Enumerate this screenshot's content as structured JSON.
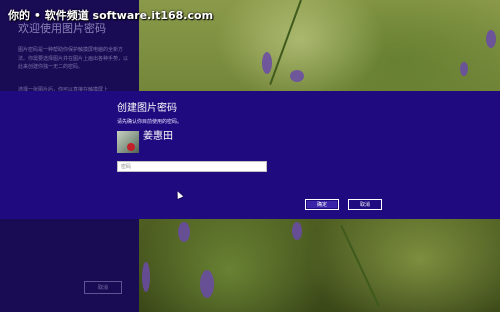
{
  "watermark": "你的 • 软件频道 software.it168.com",
  "left_panel": {
    "title": "欢迎使用图片密码",
    "body": "图片密码是一种帮助你保护触摸屏电脑的全新方法。你需要选择图片并在图片上画出各种手势，以此来创建你独一无二的密码。",
    "body2": "选择一张图片后，你可以直接在触摸屏上",
    "cancel_label": "取消"
  },
  "dialog": {
    "title": "创建图片密码",
    "instruction": "请先确认你目前使用的密码。",
    "username": "姜惠田",
    "password_placeholder": "密码",
    "ok_label": "确定",
    "cancel_label": "取消"
  },
  "colors": {
    "band": "#200a80",
    "left_panel": "#1a0b55"
  }
}
